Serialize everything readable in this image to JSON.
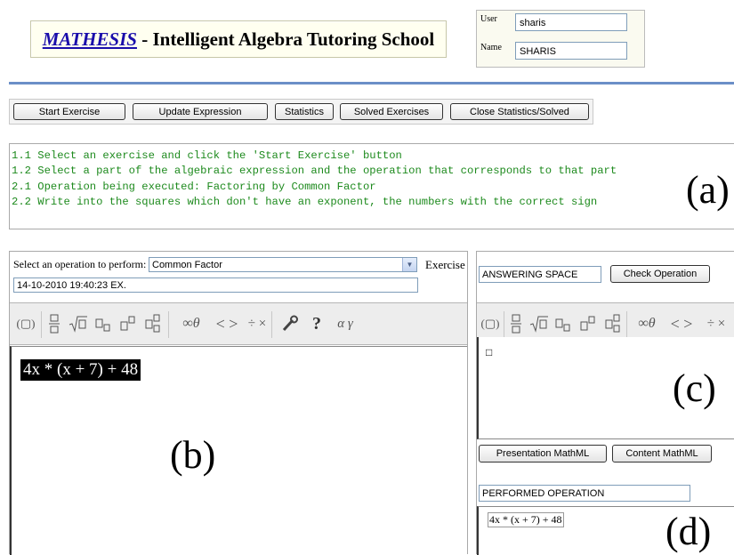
{
  "header": {
    "brand": "MATHESIS",
    "title_rest": " - Intelligent Algebra Tutoring School",
    "user_label": "User",
    "user_value": "sharis",
    "name_label": "Name",
    "name_value": "SHARIS"
  },
  "toolbar": {
    "start_exercise": "Start Exercise",
    "update_expression": "Update Expression",
    "statistics": "Statistics",
    "solved_exercises": "Solved Exercises",
    "close_stats": "Close Statistics/Solved"
  },
  "instructions": [
    "1.1 Select an exercise and click the 'Start Exercise' button",
    "1.2 Select a part of the algebraic expression and the operation that corresponds to that part",
    "2.1 Operation being executed: Factoring by Common Factor",
    "2.2 Write into the squares which don't have an exponent, the numbers with the correct sign"
  ],
  "panel_labels": {
    "a": "(a)",
    "b": "(b)",
    "c": "(c)",
    "d": "(d)"
  },
  "operation": {
    "label": "Select an operation to perform:",
    "selected": "Common Factor",
    "exercise_label": "Exercise",
    "exercise_id": "14-10-2010 19:40:23 EX."
  },
  "math_toolbar": {
    "paren": "(▢)",
    "infinity_theta": "∞θ",
    "lt_gt": "< >",
    "div_times": "÷ ×",
    "help": "?",
    "alpha_gamma": "α γ"
  },
  "expression": "4x * (x + 7) + 48",
  "answer": {
    "space_label": "ANSWERING SPACE",
    "check_button": "Check Operation",
    "placeholder_box": "□"
  },
  "mathml": {
    "presentation_button": "Presentation MathML",
    "content_button": "Content MathML",
    "performed_label": "PERFORMED OPERATION",
    "performed_expression": "4x * (x + 7) + 48"
  },
  "colors": {
    "instruction_text": "#1d8a1d",
    "link": "#1a0dab",
    "rule": "#6b8fc7"
  }
}
